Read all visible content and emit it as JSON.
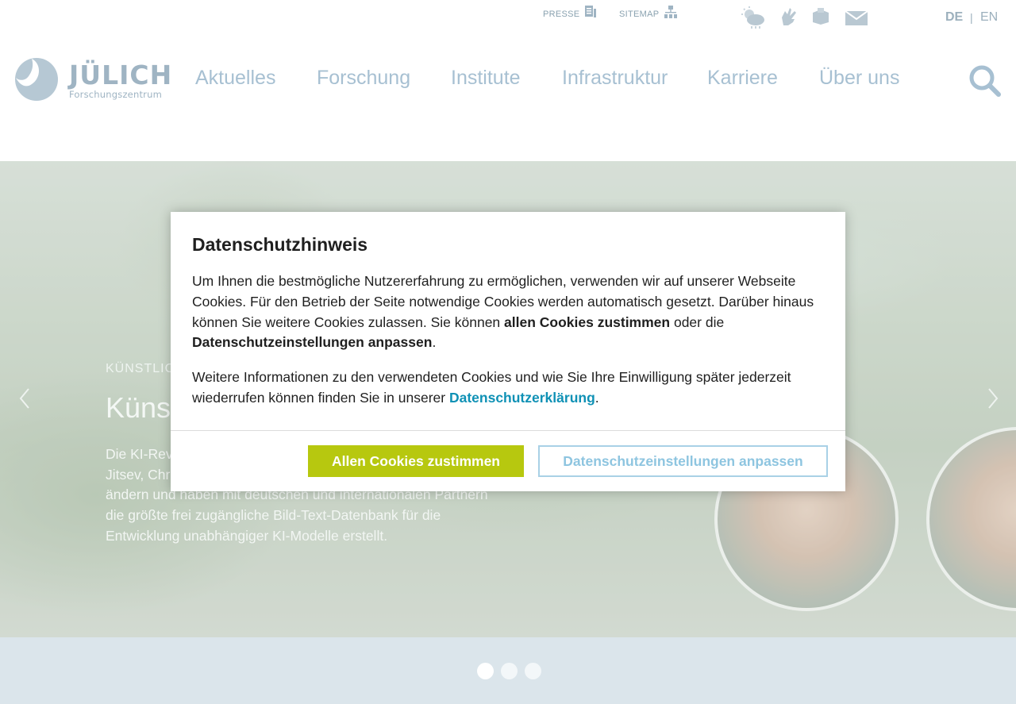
{
  "topbar": {
    "presse_label": "PRESSE",
    "sitemap_label": "SITEMAP",
    "icons": [
      "weather-icon",
      "sign-language-icon",
      "easy-language-icon",
      "mail-icon"
    ],
    "lang_de": "DE",
    "lang_sep": "|",
    "lang_en": "EN"
  },
  "logo": {
    "word": "JÜLICH",
    "sub": "Forschungszentrum"
  },
  "nav": {
    "items": [
      "Aktuelles",
      "Forschung",
      "Institute",
      "Infrastruktur",
      "Karriere",
      "Über uns"
    ]
  },
  "hero": {
    "kicker": "KÜNSTLICHE INTELLIGENZ",
    "title": "Künstliche Intelligenz",
    "body": "Die KI-Revolution findet hinter verschlossenen Türen statt. Jenia Jitsev, Christoph Schuhmann und Mehdi Cherti wollen das ändern und haben mit deutschen und internationalen Partnern die größte frei zugängliche Bild-Text-Datenbank für die Entwicklung unabhängiger KI-Modelle erstellt.",
    "slides": 3,
    "active_slide": 1
  },
  "modal": {
    "title": "Datenschutzhinweis",
    "p1_a": "Um Ihnen die bestmögliche Nutzererfahrung zu ermöglichen, verwenden wir auf unserer Webseite Cookies. Für den Betrieb der Seite notwendige Cookies werden automatisch gesetzt. Darüber hinaus können Sie weitere Cookies zulassen. Sie können ",
    "p1_b": "allen Cookies zustimmen",
    "p1_c": " oder die ",
    "p1_d": "Datenschutzeinstellungen anpassen",
    "p1_e": ".",
    "p2_a": "Weitere Informationen zu den verwendeten Cookies und wie Sie Ihre Einwilligung später jederzeit wiederrufen können finden Sie in unserer ",
    "p2_link": "Datenschutzerklärung",
    "p2_end": ".",
    "accept_label": "Allen Cookies zustimmen",
    "settings_label": "Datenschutzeinstellungen anpassen"
  },
  "colors": {
    "accent_green": "#b7c80f",
    "link_blue": "#0f91b5",
    "nav_blue": "#a7c0d2"
  }
}
